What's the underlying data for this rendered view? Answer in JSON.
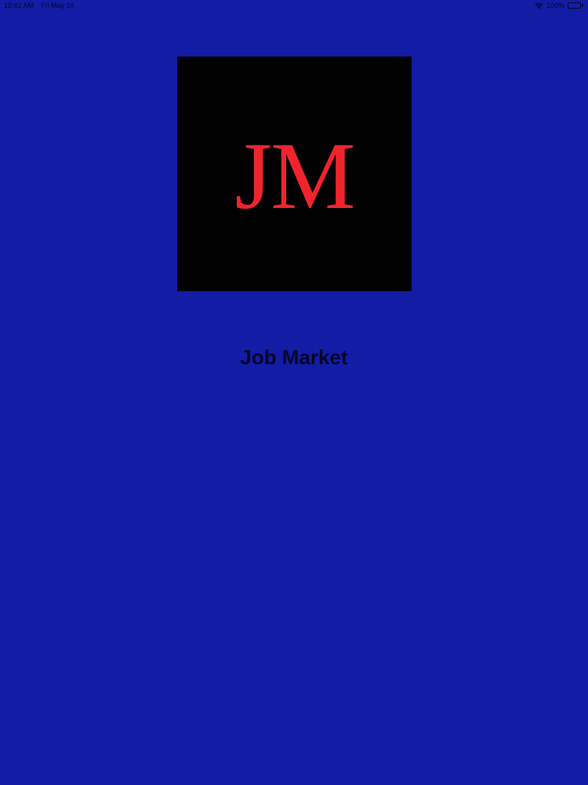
{
  "status_bar": {
    "time": "10:42 AM",
    "date": "Fri May 24",
    "wifi_icon": "wifi-icon",
    "battery_percent": "100%",
    "battery_icon": "battery-full-icon"
  },
  "logo": {
    "text": "JM",
    "background_color": "#000000",
    "text_color": "#f0242d"
  },
  "app": {
    "title": "Job Market"
  },
  "colors": {
    "background": "#131ca5",
    "title_text": "#05062a"
  }
}
